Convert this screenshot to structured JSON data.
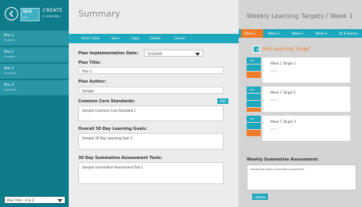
{
  "sidebar": {
    "back_icon": "arrow-left-icon",
    "logo_line1": "ULU",
    "logo_line2": "unit",
    "create_title": "CREATE",
    "create_sub": "a new plan",
    "plans": [
      {
        "title": "Plan 1",
        "date": "5/1/2019"
      },
      {
        "title": "Plan 2",
        "date": "5/7/2019"
      },
      {
        "title": "Plan 3",
        "date": "5/14/2019"
      },
      {
        "title": "Plan 4",
        "date": "5/21/2019"
      }
    ],
    "filter_value": "Plan Title - A to Z"
  },
  "main": {
    "title": "Summary",
    "toolbar": {
      "print": "Print / View",
      "save": "Save",
      "copy": "Copy",
      "delete": "Delete",
      "cancel": "Cancel"
    },
    "impl_date_label": "Plan Implementation Date:",
    "impl_date_value": "5/1/2019",
    "plan_title_label": "Plan Title:",
    "plan_title_value": "Plan 1",
    "plan_author_label": "Plan Author:",
    "plan_author_value": "Sample",
    "ccs_label": "Common Core Standards:",
    "ccs_add": "Add",
    "ccs_value": "Sample Common Core Standard 1",
    "goals_label": "Overall 30 Day Learning Goals:",
    "goals_value": "Sample 30 Day Learning Goal 1",
    "tools_label": "30 Day Summative Assessment Tools:",
    "tools_value": "Sample Summative Assessment Tool 1"
  },
  "right": {
    "title": "Weekly Learning Targets / Week 1",
    "tabs": [
      "Week 1",
      "Week 2",
      "Week 3",
      "Week 4",
      "W. K Source"
    ],
    "add_target": "Add Learning Target",
    "targets": [
      {
        "title": "Week 1 Target 1",
        "value": "Video",
        "edit": "Edit"
      },
      {
        "title": "Week 1 Target 2",
        "value": "Video",
        "edit": "Edit"
      },
      {
        "title": "Week 1 Target 3",
        "value": "Video",
        "edit": "Edit"
      }
    ],
    "summative_label": "Weekly Summative Assessment:",
    "summative_value": "Sample Plan Week 1 Summative Assessment",
    "update": "Update"
  }
}
